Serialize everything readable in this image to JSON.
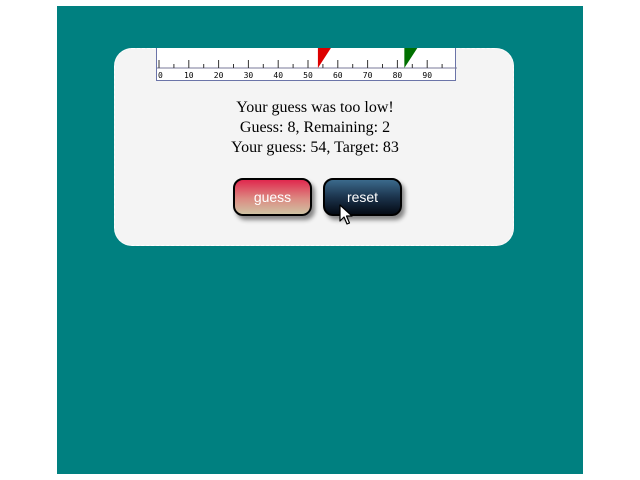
{
  "ruler": {
    "min": 0,
    "max": 99,
    "tick_labels": [
      "0",
      "10",
      "20",
      "30",
      "40",
      "50",
      "60",
      "70",
      "80",
      "90"
    ],
    "guess_value": 54,
    "target_value": 83,
    "guess_color": "#dd0000",
    "target_color": "#007000"
  },
  "status": {
    "result": "Your guess was too low!",
    "counts": "Guess: 8, Remaining: 2",
    "values": "Your guess: 54, Target: 83"
  },
  "buttons": {
    "guess_label": "guess",
    "reset_label": "reset"
  },
  "colors": {
    "background": "#008080",
    "panel": "#f4f4f4"
  },
  "icons": {
    "cursor": "arrow-pointer-icon"
  }
}
